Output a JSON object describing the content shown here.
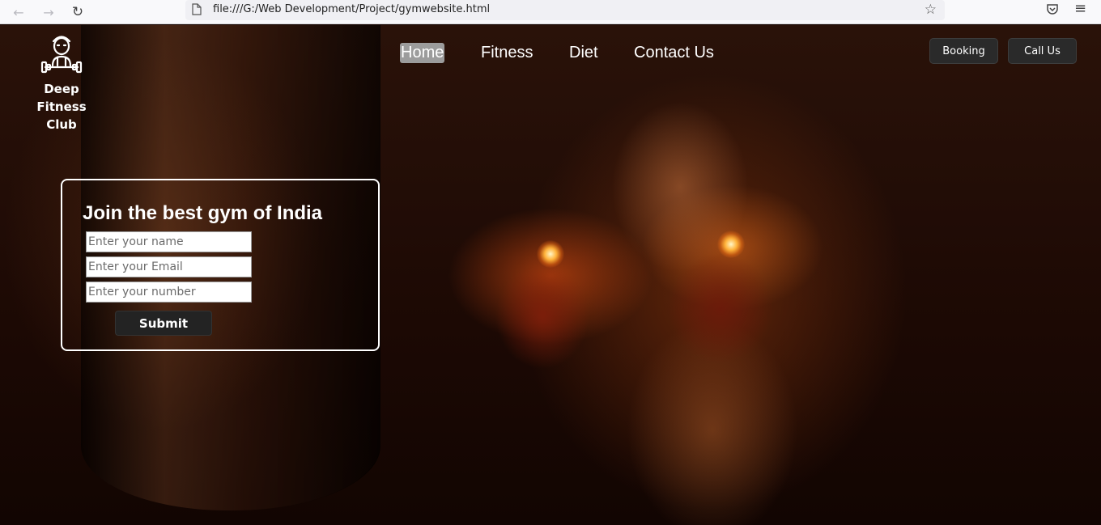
{
  "browser": {
    "back_icon": "back-arrow-icon",
    "forward_icon": "forward-arrow-icon",
    "reload_icon": "reload-icon",
    "url": "file:///G:/Web Development/Project/gymwebsite.html"
  },
  "logo": {
    "icon": "trainer-with-barbell-icon",
    "line1": "Deep Fitness",
    "line2": "Club"
  },
  "nav": {
    "items": [
      {
        "label": "Home",
        "active": true
      },
      {
        "label": "Fitness",
        "active": false
      },
      {
        "label": "Diet",
        "active": false
      },
      {
        "label": "Contact Us",
        "active": false
      }
    ]
  },
  "actions": {
    "booking_label": "Booking",
    "call_label": "Call Us"
  },
  "form": {
    "title": "Join the best gym of India",
    "name_placeholder": "Enter your name",
    "email_placeholder": "Enter your Email",
    "number_placeholder": "Enter your number",
    "submit_label": "Submit"
  },
  "colors": {
    "page_background": "#1a0a05",
    "active_nav_bg": "#9c9c9c",
    "button_bg": "#2a2a2a"
  }
}
